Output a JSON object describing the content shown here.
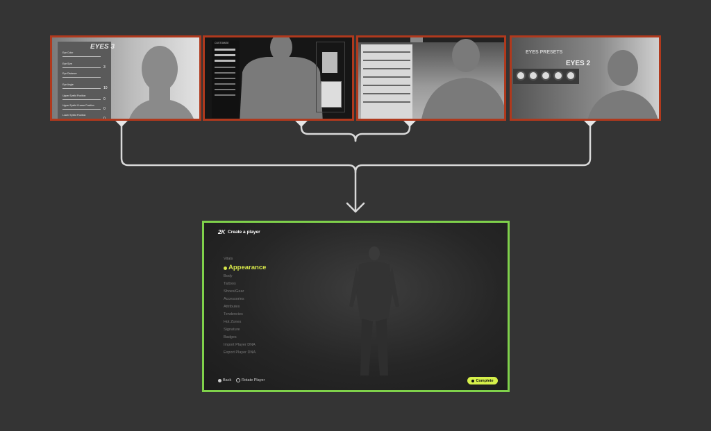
{
  "colors": {
    "background": "#343434",
    "legacy_border": "#b0391d",
    "new_border": "#7fd14b",
    "connector": "#d9d9d9",
    "accent_yellow": "#d6e64a"
  },
  "legacy_screens": [
    {
      "title": "EYES 3",
      "rows": [
        {
          "label": "Eye Color",
          "value": ""
        },
        {
          "label": "Eye Size",
          "value": "3"
        },
        {
          "label": "Eye Distance",
          "value": ""
        },
        {
          "label": "Eye Angle",
          "value": "10"
        },
        {
          "label": "Upper Eyelid Position",
          "value": "0"
        },
        {
          "label": "Upper Eyelid Crease Position",
          "value": "0"
        },
        {
          "label": "Lower Eyelid Position",
          "value": "0"
        }
      ]
    },
    {
      "title": "CUSTOMIZE"
    },
    {
      "title": ""
    },
    {
      "title": "EYES 2",
      "subtitle": "EYES PRESETS"
    }
  ],
  "new_screen": {
    "header_title": "Create a player",
    "menu": [
      {
        "label": "Vitals"
      },
      {
        "label": "Appearance",
        "active": true
      },
      {
        "label": "Body"
      },
      {
        "label": "Tattoos"
      },
      {
        "label": "Shoes/Gear"
      },
      {
        "label": "Accessories"
      },
      {
        "label": "Attributes"
      },
      {
        "label": "Tendencies"
      },
      {
        "label": "Hot Zones"
      },
      {
        "label": "Signature"
      },
      {
        "label": "Badges"
      },
      {
        "label": "Import Player DNA"
      },
      {
        "label": "Export Player DNA"
      }
    ],
    "footer": {
      "back_label": "Back",
      "rotate_label": "Rotate Player",
      "complete_label": "Complete"
    }
  }
}
